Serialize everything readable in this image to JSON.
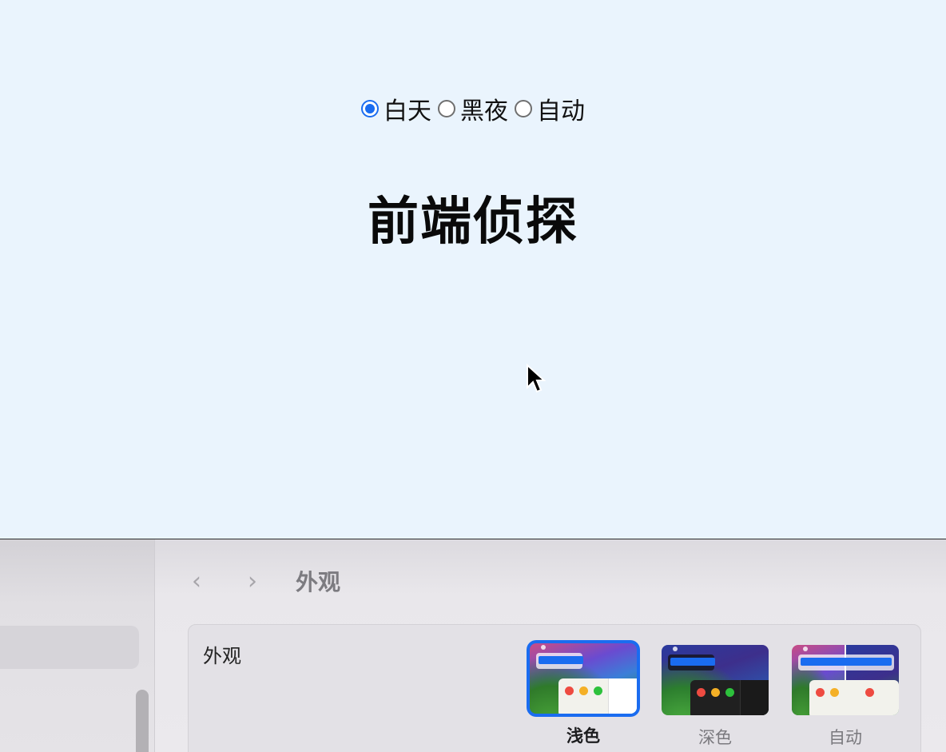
{
  "webpage": {
    "theme_options": [
      {
        "label": "白天",
        "checked": true
      },
      {
        "label": "黑夜",
        "checked": false
      },
      {
        "label": "自动",
        "checked": false
      }
    ],
    "title": "前端侦探"
  },
  "settings_window": {
    "nav": {
      "back_icon": "chevron-left-icon",
      "forward_icon": "chevron-right-icon"
    },
    "title": "外观",
    "section_label": "外观",
    "appearance_options": [
      {
        "label": "浅色",
        "selected": true
      },
      {
        "label": "深色",
        "selected": false
      },
      {
        "label": "自动",
        "selected": false
      }
    ],
    "accent_color": "#1a6cf0"
  }
}
